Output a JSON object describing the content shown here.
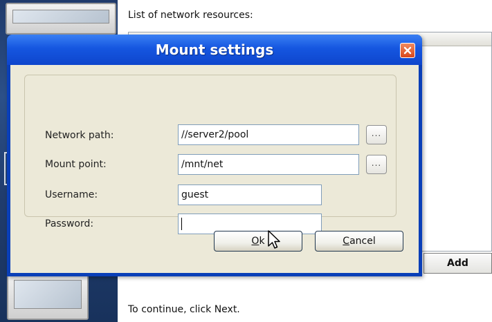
{
  "background_window": {
    "list_title": "List of network resources:",
    "add_button": "Add",
    "footer_text": "To continue, click Next."
  },
  "dialog": {
    "title": "Mount settings",
    "fields": {
      "network_path": {
        "label": "Network path:",
        "value": "//server2/pool"
      },
      "mount_point": {
        "label": "Mount point:",
        "value": "/mnt/net"
      },
      "username": {
        "label": "Username:",
        "value": "guest"
      },
      "password": {
        "label": "Password:",
        "value": ""
      }
    },
    "browse_label": "...",
    "ok_button": {
      "underlined": "O",
      "rest": "k"
    },
    "cancel_button": {
      "underlined": "C",
      "rest": "ancel"
    }
  },
  "colors": {
    "titlebar": "#1556e0",
    "close": "#d8461b",
    "dialog_face": "#ece9d8"
  }
}
